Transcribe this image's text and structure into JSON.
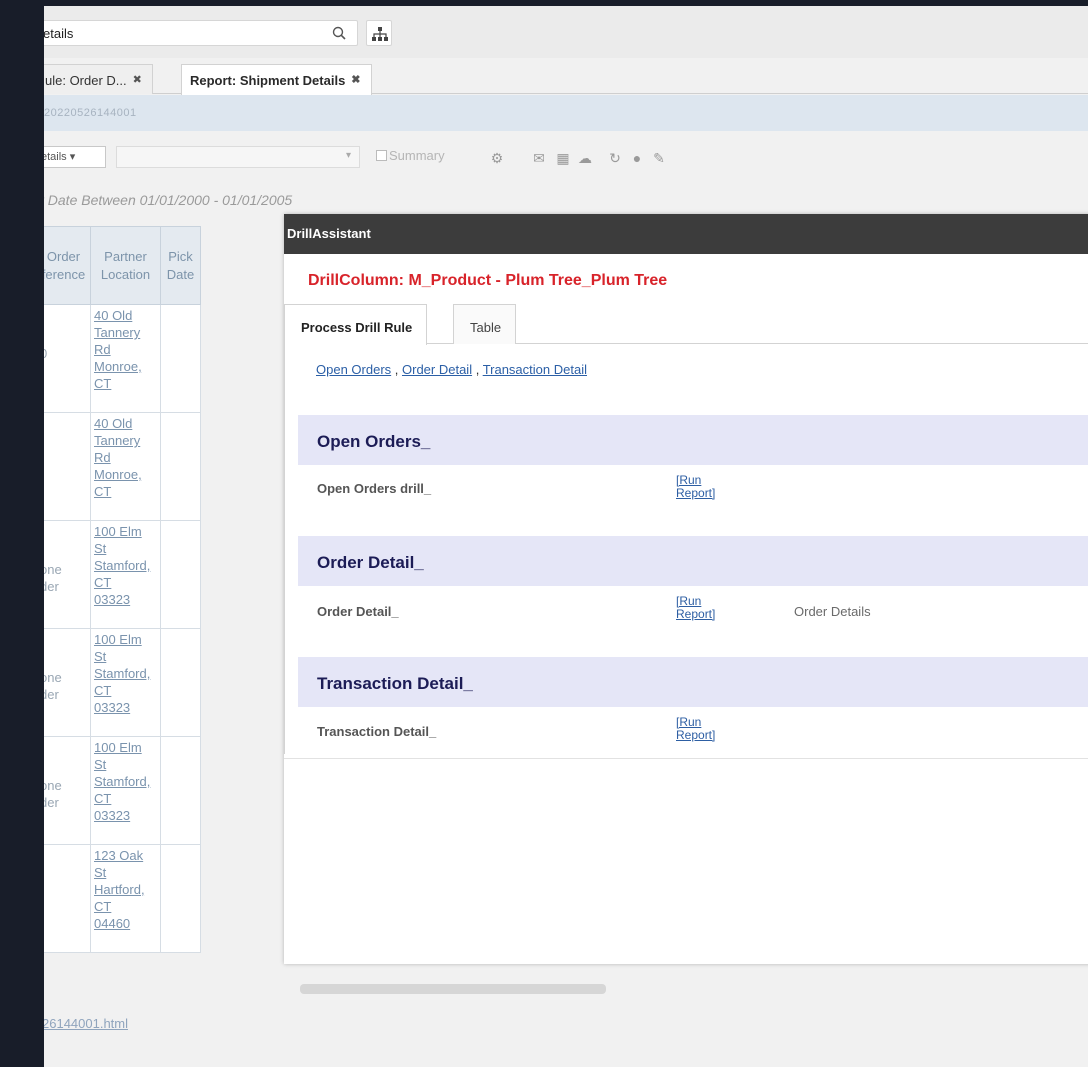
{
  "search": {
    "value": "etails"
  },
  "tabs": [
    {
      "label": "ule: Order D...",
      "active": false
    },
    {
      "label": "Report: Shipment Details",
      "active": true
    }
  ],
  "tab_close_glyph": "✖",
  "report_id": "20220526144001",
  "toolbar": {
    "view_select": "etails",
    "summary_label": "Summary",
    "icons": [
      "settings-icon",
      "email-icon",
      "grid-icon",
      "cloud-icon",
      "refresh-icon",
      "gear-icon",
      "pencil-icon"
    ]
  },
  "filter_text": "t Date Between 01/01/2000 - 01/01/2005",
  "table": {
    "headers": [
      "Order\nference",
      "Partner\nLocation",
      "Pick\nDate"
    ],
    "rows": [
      {
        "c1": "0",
        "addr": "40 Old\nTannery\nRd\nMonroe,\nCT"
      },
      {
        "c1": "",
        "addr": "40 Old\nTannery\nRd\nMonroe,\nCT"
      },
      {
        "c1": "one\nder",
        "addr": "100 Elm\nSt\nStamford,\nCT\n03323"
      },
      {
        "c1": "one\nder",
        "addr": "100 Elm\nSt\nStamford,\nCT\n03323"
      },
      {
        "c1": "one\nder",
        "addr": "100 Elm\nSt\nStamford,\nCT\n03323"
      },
      {
        "c1": "",
        "addr": "123 Oak\nSt\nHartford,\nCT\n04460"
      }
    ]
  },
  "footer_link": "26144001.html",
  "dialog": {
    "title": "DrillAssistant",
    "drill_column": "DrillColumn: M_Product - Plum Tree_Plum Tree",
    "tabs": [
      "Process Drill Rule",
      "Table"
    ],
    "crumbs": [
      "Open Orders",
      "Order Detail",
      "Transaction Detail"
    ],
    "crumb_sep": " , ",
    "sections": [
      {
        "title": "Open Orders_",
        "row_label": "Open Orders drill_",
        "run_link": "[Run\nReport]",
        "extra": ""
      },
      {
        "title": "Order Detail_",
        "row_label": "Order Detail_",
        "run_link": "[Run\nReport]",
        "extra": "Order Details"
      },
      {
        "title": "Transaction Detail_",
        "row_label": "Transaction Detail_",
        "run_link": "[Run\nReport]",
        "extra": ""
      }
    ]
  },
  "colors": {
    "backdrop": "#181d29",
    "dialog_header": "#3c3c3c",
    "drill_column": "#d8232a",
    "section_bg": "#e5e6f7",
    "section_title": "#1c1c56",
    "link": "#2b5fa6"
  }
}
